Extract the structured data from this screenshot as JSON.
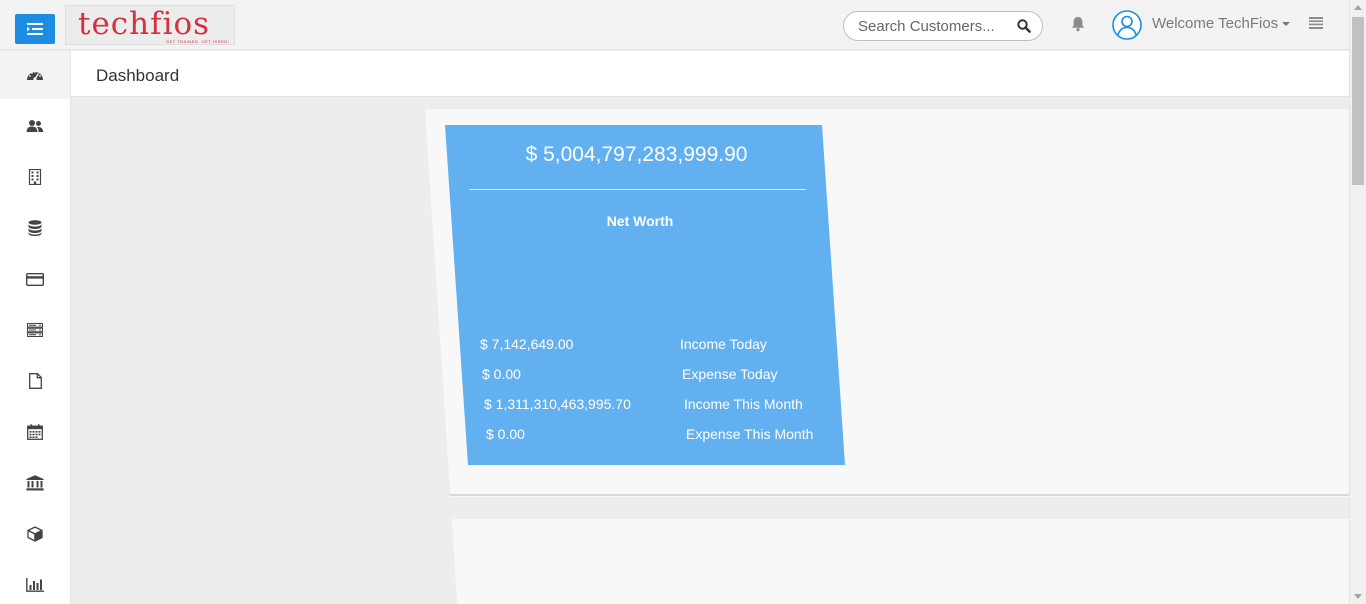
{
  "header": {
    "logo_text": "techfios",
    "logo_tagline": "GET TRAINED. GET HIRED!",
    "search_placeholder": "Search Customers...",
    "welcome_text": "Welcome TechFios"
  },
  "sidebar": {
    "items": [
      {
        "icon": "dashboard-icon"
      },
      {
        "icon": "users-icon"
      },
      {
        "icon": "building-icon"
      },
      {
        "icon": "database-icon"
      },
      {
        "icon": "credit-card-icon"
      },
      {
        "icon": "server-icon"
      },
      {
        "icon": "file-icon"
      },
      {
        "icon": "calendar-icon"
      },
      {
        "icon": "bank-icon"
      },
      {
        "icon": "cube-icon"
      },
      {
        "icon": "bar-chart-icon"
      }
    ]
  },
  "page": {
    "title": "Dashboard"
  },
  "networth_card": {
    "value": "$ 5,004,797,283,999.90",
    "label": "Net Worth",
    "stats": [
      {
        "value": "$ 7,142,649.00",
        "label": "Income Today"
      },
      {
        "value": "$ 0.00",
        "label": "Expense Today"
      },
      {
        "value": "$ 1,311,310,463,995.70",
        "label": "Income This Month"
      },
      {
        "value": "$ 0.00",
        "label": "Expense This Month"
      }
    ]
  },
  "colors": {
    "accent": "#1c8de3",
    "card": "#62b0f0",
    "logo": "#d3313e"
  }
}
